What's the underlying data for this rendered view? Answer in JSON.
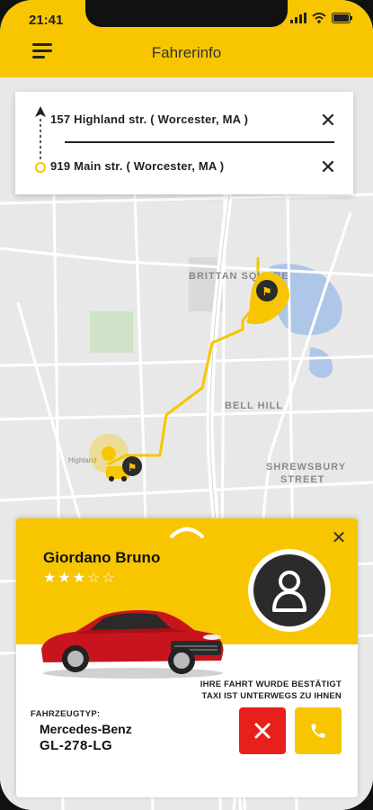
{
  "status_bar": {
    "time": "21:41"
  },
  "header": {
    "title": "Fahrerinfo"
  },
  "route": {
    "origin": "157 Highland str. ( Worcester, MA )",
    "destination": "919 Main str. ( Worcester, MA )"
  },
  "map": {
    "labels": {
      "brittan": "BRITTAN SQUARE",
      "bell_hill": "BELL HILL",
      "shrewsbury_1": "SHREWSBURY",
      "shrewsbury_2": "STREET",
      "highland": "Highland"
    }
  },
  "driver": {
    "name": "Giordano Bruno",
    "rating_stars": "★★★☆☆",
    "rating": 3.5
  },
  "trip": {
    "confirm_line1": "IHRE FAHRT WURDE BESTÄTIGT",
    "confirm_line2": "TAXI IST UNTERWEGS ZU IHNEN"
  },
  "vehicle": {
    "type_label": "FAHRZEUGTYP:",
    "model": "Mercedes-Benz",
    "plate": "GL-278-LG"
  },
  "colors": {
    "accent": "#f7c600",
    "danger": "#e8201c",
    "dark": "#2b2b2b",
    "map_bg": "#e9e9e9",
    "route": "#f7c600"
  },
  "icons": {
    "menu": "hamburger-icon",
    "close": "close-icon",
    "user": "user-icon",
    "cancel": "x-icon",
    "call": "phone-icon"
  }
}
